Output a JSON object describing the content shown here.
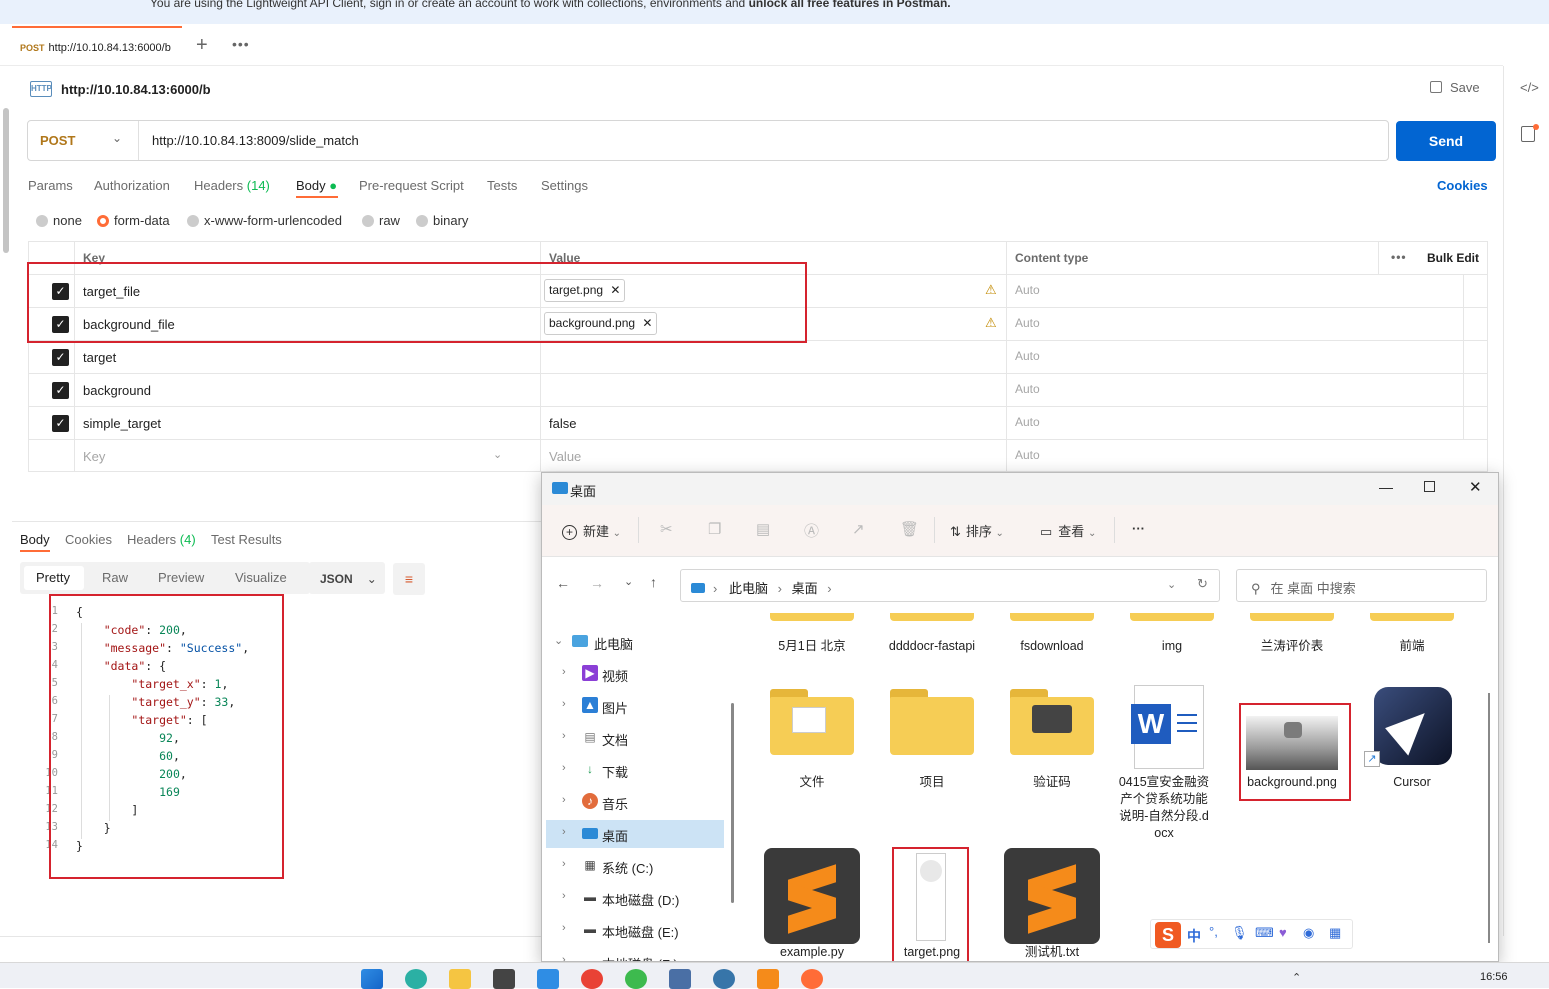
{
  "banner": {
    "text": "You are using the Lightweight API Client, sign in or create an account to work with collections, environments and ",
    "bold": "unlock all free features in Postman."
  },
  "tab": {
    "method": "POST",
    "label": "http://10.10.84.13:6000/b"
  },
  "request": {
    "http_badge": "HTTP",
    "title": "http://10.10.84.13:6000/b",
    "save_label": "Save",
    "method": "POST",
    "url": "http://10.10.84.13:8009/slide_match",
    "send_label": "Send"
  },
  "subtabs": [
    {
      "label": "Params"
    },
    {
      "label": "Authorization"
    },
    {
      "label": "Headers"
    },
    {
      "label": "Body"
    },
    {
      "label": "Pre-request Script"
    },
    {
      "label": "Tests"
    },
    {
      "label": "Settings"
    }
  ],
  "headers_count": "(14)",
  "cookies_label": "Cookies",
  "body_types": [
    "none",
    "form-data",
    "x-www-form-urlencoded",
    "raw",
    "binary"
  ],
  "table": {
    "headers": {
      "key": "Key",
      "value": "Value",
      "content_type": "Content type",
      "bulk_edit": "Bulk Edit"
    },
    "rows": [
      {
        "key": "target_file",
        "value": "target.png",
        "content_type": "Auto"
      },
      {
        "key": "background_file",
        "value": "background.png",
        "content_type": "Auto"
      },
      {
        "key": "target",
        "value": "",
        "content_type": "Auto"
      },
      {
        "key": "background",
        "value": "",
        "content_type": "Auto"
      },
      {
        "key": "simple_target",
        "value": "false",
        "content_type": "Auto"
      }
    ],
    "placeholder": {
      "key": "Key",
      "value": "Value",
      "content_type": "Auto"
    }
  },
  "response": {
    "tabs": [
      "Body",
      "Cookies",
      "Headers",
      "Test Results"
    ],
    "headers_count": "(4)",
    "views": [
      "Pretty",
      "Raw",
      "Preview",
      "Visualize"
    ],
    "format": "JSON",
    "json_lines": [
      {
        "n": "1",
        "t": "{"
      },
      {
        "n": "2",
        "t": "    \"code\": 200,"
      },
      {
        "n": "3",
        "t": "    \"message\": \"Success\","
      },
      {
        "n": "4",
        "t": "    \"data\": {"
      },
      {
        "n": "5",
        "t": "        \"target_x\": 1,"
      },
      {
        "n": "6",
        "t": "        \"target_y\": 33,"
      },
      {
        "n": "7",
        "t": "        \"target\": ["
      },
      {
        "n": "8",
        "t": "            92,"
      },
      {
        "n": "9",
        "t": "            60,"
      },
      {
        "n": "10",
        "t": "            200,"
      },
      {
        "n": "11",
        "t": "            169"
      },
      {
        "n": "12",
        "t": "        ]"
      },
      {
        "n": "13",
        "t": "    }"
      },
      {
        "n": "14",
        "t": "}"
      }
    ]
  },
  "explorer": {
    "title": "桌面",
    "toolbar": {
      "new": "新建",
      "sort": "排序",
      "view": "查看",
      "more": "···"
    },
    "breadcrumb": [
      "此电脑",
      "桌面"
    ],
    "search_placeholder": "在 桌面 中搜索",
    "nav": [
      {
        "label": "此电脑",
        "icon": "computer-icon"
      },
      {
        "label": "视频",
        "icon": "video-icon"
      },
      {
        "label": "图片",
        "icon": "picture-icon"
      },
      {
        "label": "文档",
        "icon": "document-icon"
      },
      {
        "label": "下载",
        "icon": "download-icon"
      },
      {
        "label": "音乐",
        "icon": "music-icon"
      },
      {
        "label": "桌面",
        "icon": "desktop-icon"
      },
      {
        "label": "系统 (C:)",
        "icon": "drive-icon"
      },
      {
        "label": "本地磁盘 (D:)",
        "icon": "drive-icon"
      },
      {
        "label": "本地磁盘 (E:)",
        "icon": "drive-icon"
      },
      {
        "label": "本地磁盘 (F:)",
        "icon": "drive-icon"
      }
    ],
    "files_row1": [
      "5月1日 北京",
      "ddddocr-fastapi",
      "fsdownload",
      "img",
      "兰涛评价表",
      "前端"
    ],
    "files_row2": [
      "文件",
      "项目",
      "验证码",
      "0415宣安金融资产个贷系统功能说明-自然分段.docx",
      "background.png",
      "Cursor"
    ],
    "files_row3": [
      "example.py",
      "target.png",
      "测试机.txt"
    ]
  },
  "ime": {
    "label": "中"
  },
  "clock": "16:56"
}
